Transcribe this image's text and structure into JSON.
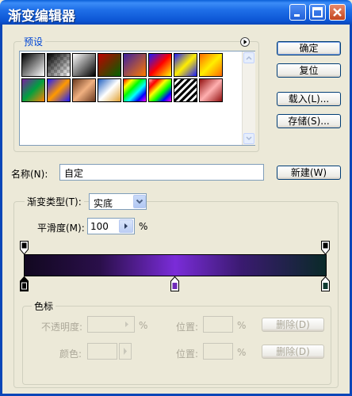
{
  "window": {
    "title": "渐变编辑器"
  },
  "presets": {
    "label": "预设"
  },
  "buttons": {
    "ok": "确定",
    "reset": "复位",
    "load": "载入(L)...",
    "save": "存储(S)...",
    "new": "新建(W)"
  },
  "name": {
    "label": "名称(N):",
    "value": "自定"
  },
  "gradient_type": {
    "label": "渐变类型(T):",
    "value": "实底"
  },
  "smoothness": {
    "label": "平滑度(M):",
    "value": "100",
    "unit": "%"
  },
  "stops": {
    "label": "色标",
    "opacity_label": "不透明度:",
    "opacity_unit": "%",
    "location_label": "位置:",
    "location_unit": "%",
    "delete_label": "删除(D)",
    "color_label": "颜色:",
    "color_location_label": "位置:",
    "color_location_unit": "%",
    "color_delete_label": "删除(D)"
  },
  "gradient_colors": {
    "start": "#120820",
    "mid": "#7a2cd8",
    "end": "#0a2a28"
  },
  "color_stops": [
    {
      "position": 0,
      "color": "#000000"
    },
    {
      "position": 50,
      "color": "#6f2bb8"
    },
    {
      "position": 100,
      "color": "#0e3a30"
    }
  ]
}
